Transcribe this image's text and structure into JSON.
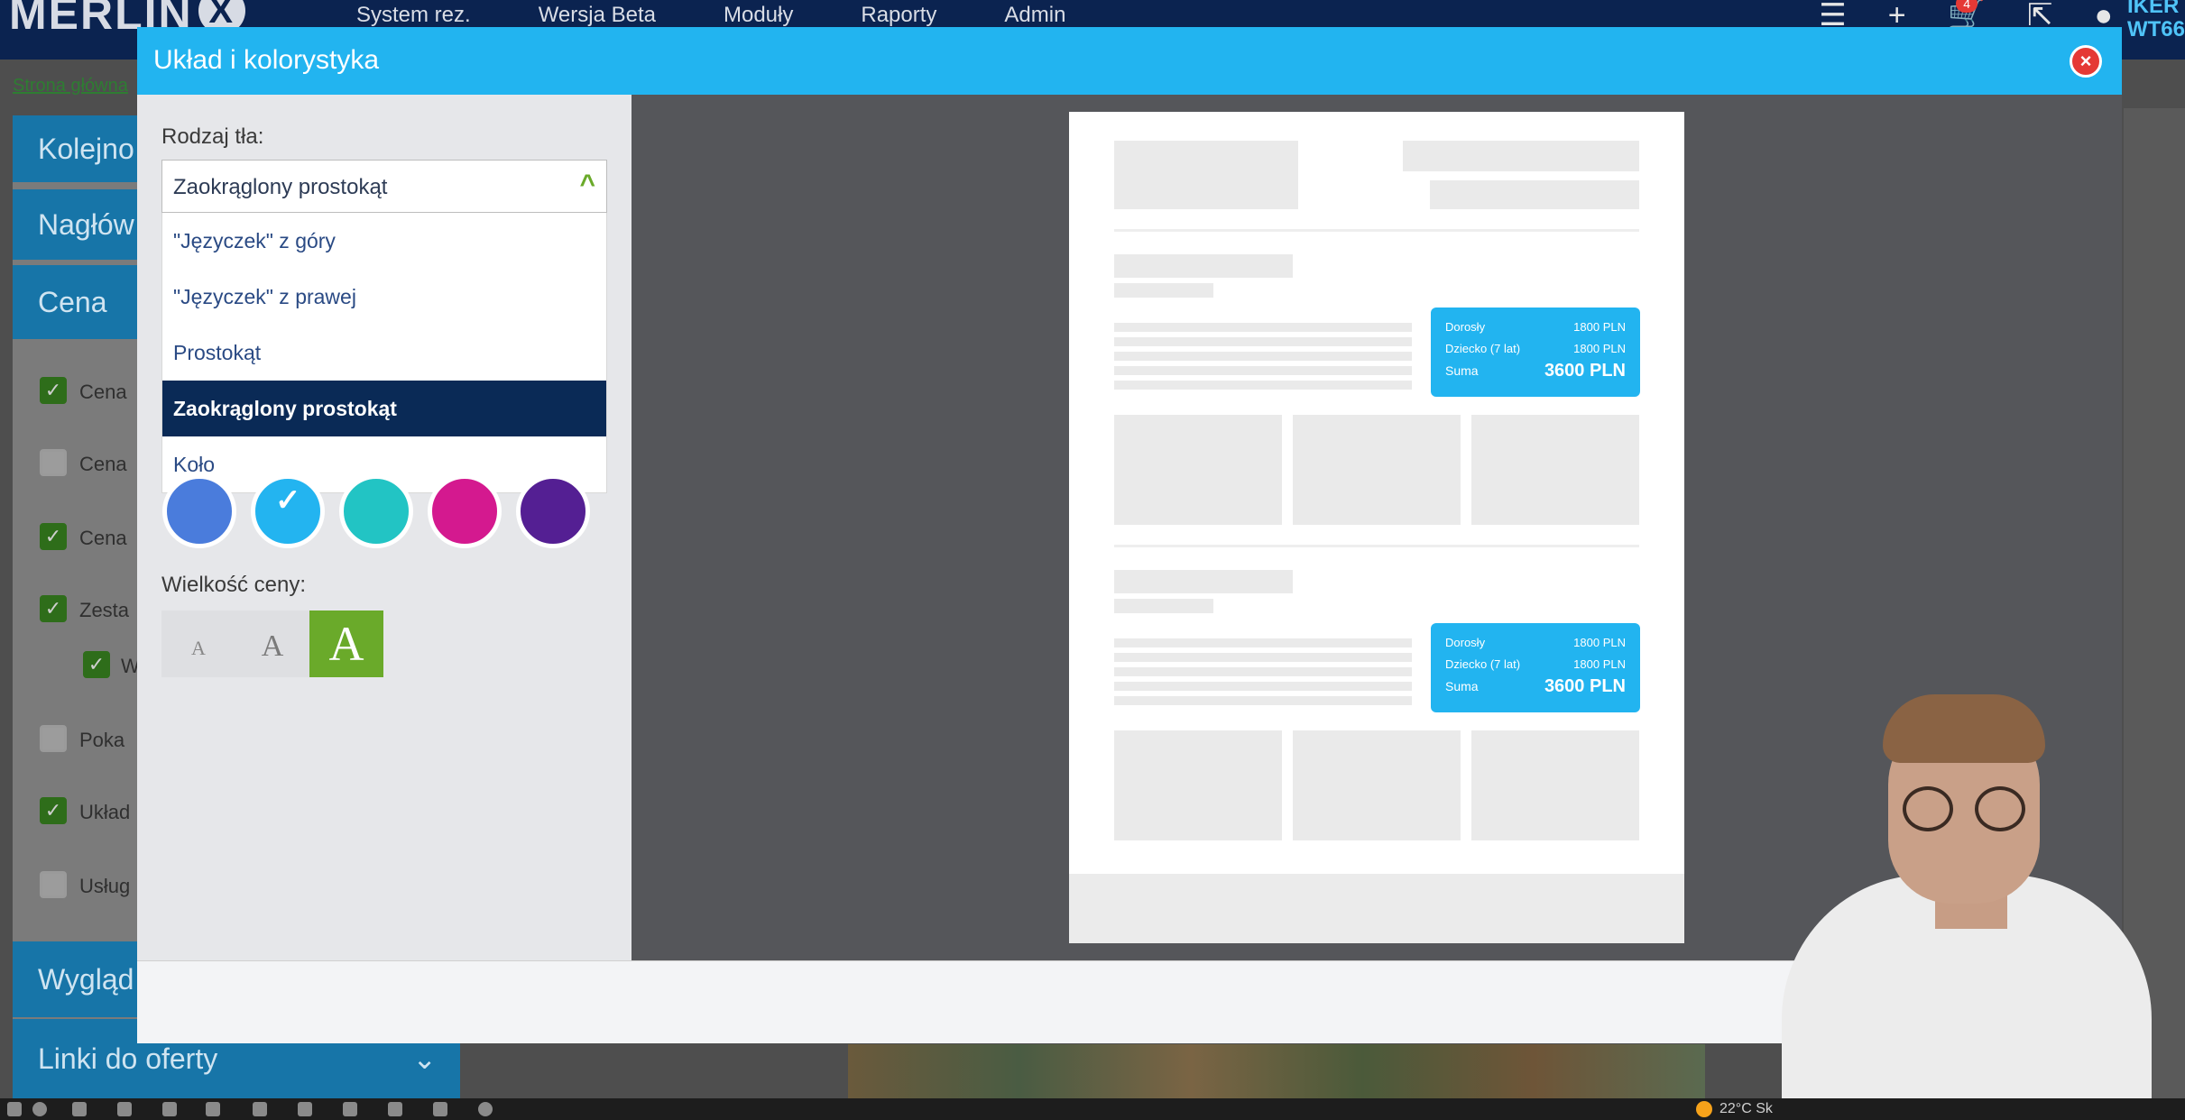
{
  "topbar": {
    "logo": "MERLIN",
    "logo_mark": "X",
    "nav": [
      "System rez.",
      "Wersja Beta",
      "Moduły",
      "Raporty",
      "Admin"
    ],
    "cart_count": "4",
    "user_line1": "IKER",
    "user_line2": "WT66"
  },
  "background": {
    "breadcrumb": "Strona główna",
    "accordion": [
      "Kolejno",
      "Nagłów",
      "Cena"
    ],
    "accordion_bottom": [
      "Wygląd",
      "Linki do oferty"
    ],
    "checkbox_labels": [
      "Cena",
      "Cena",
      "Cena",
      "Zesta",
      "W",
      "Poka",
      "Układ",
      "Usług"
    ]
  },
  "modal": {
    "title": "Układ i kolorystyka",
    "background_type_label": "Rodzaj tła:",
    "selected_value": "Zaokrąglony prostokąt",
    "options": [
      "\"Języczek\" z góry",
      "\"Języczek\" z prawej",
      "Prostokąt",
      "Zaokrąglony prostokąt",
      "Koło"
    ],
    "selected_option_index": 3,
    "colors": [
      "#4a7cdc",
      "#23b4f0",
      "#22c4c4",
      "#d4198f",
      "#541f93"
    ],
    "selected_color_index": 1,
    "price_size_label": "Wielkość ceny:",
    "sizes": [
      "A",
      "A",
      "A"
    ],
    "selected_size_index": 2
  },
  "preview": {
    "price_box_1": {
      "rows": [
        {
          "label": "Dorosły",
          "value": "1800 PLN"
        },
        {
          "label": "Dziecko (7 lat)",
          "value": "1800 PLN"
        }
      ],
      "sum_label": "Suma",
      "sum_value": "3600 PLN"
    },
    "price_box_2": {
      "rows": [
        {
          "label": "Dorosły",
          "value": "1800 PLN"
        },
        {
          "label": "Dziecko (7 lat)",
          "value": "1800 PLN"
        }
      ],
      "sum_label": "Suma",
      "sum_value": "3600 PLN"
    }
  },
  "taskbar": {
    "weather": "22°C Sk"
  },
  "colors": {
    "header_blue": "#22b4f0",
    "navbar_navy": "#0b2350",
    "selected_option": "#0a2a56",
    "accent_green": "#6aaa2a",
    "close_red": "#e53935"
  }
}
